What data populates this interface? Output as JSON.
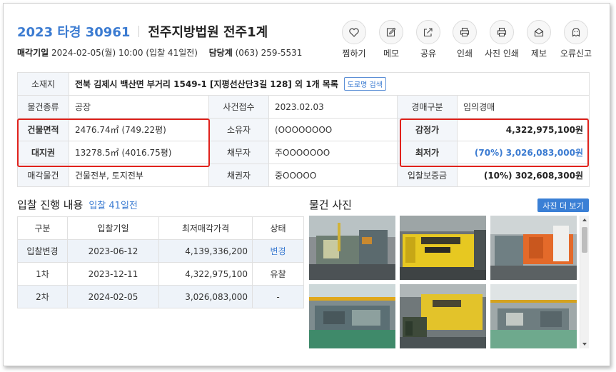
{
  "header": {
    "case_number": "2023 타경 30961",
    "court": "전주지방법원 전주1계",
    "auction_date_label": "매각기일",
    "auction_date": "2024-02-05(월) 10:00 (입찰 41일전)",
    "dept_label": "담당계",
    "dept_phone": "(063) 259-5531"
  },
  "actions": [
    {
      "label": "찜하기",
      "icon": "heart-icon"
    },
    {
      "label": "메모",
      "icon": "memo-icon"
    },
    {
      "label": "공유",
      "icon": "share-icon"
    },
    {
      "label": "인쇄",
      "icon": "print-icon"
    },
    {
      "label": "사진 인쇄",
      "icon": "print-photo-icon"
    },
    {
      "label": "제보",
      "icon": "mail-icon"
    },
    {
      "label": "오류신고",
      "icon": "ghost-icon"
    }
  ],
  "info": {
    "location_label": "소재지",
    "location": "전북 김제시 백산면 부거리 1549-1 [지평선산단3길 128] 외 1개 목록",
    "road_btn": "도로명 검색",
    "type_label": "물건종류",
    "type": "공장",
    "received_label": "사건접수",
    "received": "2023.02.03",
    "category_label": "경매구분",
    "category": "임의경매",
    "building_area_label": "건물면적",
    "building_area": "2476.74㎡ (749.22평)",
    "owner_label": "소유자",
    "owner": "(OOOOOOOO",
    "appraisal_label": "감정가",
    "appraisal": "4,322,975,100원",
    "land_label": "대지권",
    "land": "13278.5㎡ (4016.75평)",
    "debtor_label": "채무자",
    "debtor": "주OOOOOOO",
    "min_price_label": "최저가",
    "min_price": "(70%) 3,026,083,000원",
    "sale_item_label": "매각물건",
    "sale_item": "건물전부, 토지전부",
    "creditor_label": "채권자",
    "creditor": "중OOOOO",
    "deposit_label": "입찰보증금",
    "deposit": "(10%) 302,608,300원"
  },
  "bid_section": {
    "title": "입찰 진행 내용",
    "subtitle": "입찰 41일전",
    "headers": [
      "구분",
      "입찰기일",
      "최저매각가격",
      "상태"
    ],
    "rows": [
      [
        "입찰변경",
        "2023-06-12",
        "4,139,336,200",
        "변경"
      ],
      [
        "1차",
        "2023-12-11",
        "4,322,975,100",
        "유찰"
      ],
      [
        "2차",
        "2024-02-05",
        "3,026,083,000",
        "-"
      ]
    ]
  },
  "photos": {
    "title": "물건 사진",
    "more_btn": "사진 더 보기"
  },
  "colors": {
    "accent": "#3b7bd1",
    "highlight_box": "#e0221c",
    "header_cell": "#f3f6fa"
  }
}
